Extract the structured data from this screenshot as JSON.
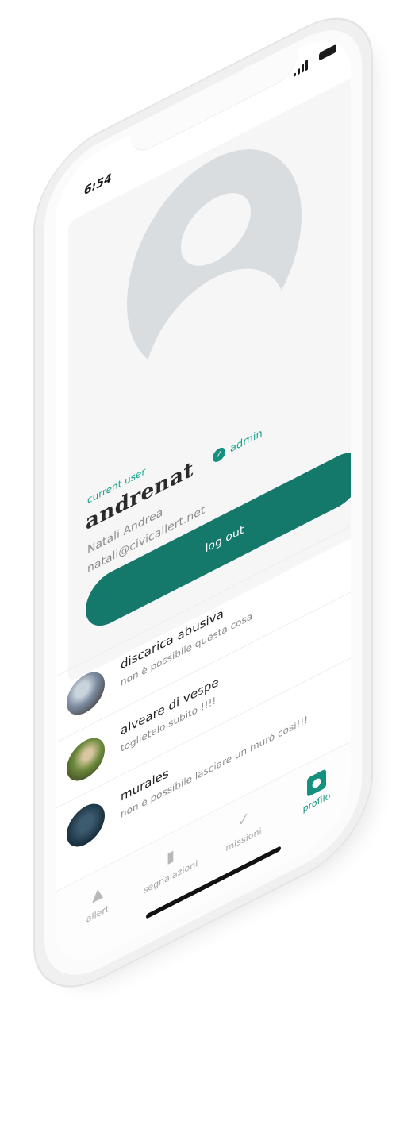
{
  "status_bar": {
    "time": "6:54"
  },
  "profile": {
    "current_user_label": "current user",
    "username": "andrenat",
    "role": "admin",
    "full_name": "Natali Andrea",
    "email": "natali@civicallert.net",
    "logout_label": "log out"
  },
  "reports": [
    {
      "title": "discarica abusiva",
      "subtitle": "non è possibile questa cosa"
    },
    {
      "title": "alveare di vespe",
      "subtitle": "toglietelo subito !!!!"
    },
    {
      "title": "murales",
      "subtitle": "non è possibile lasciare un murò così!!!"
    }
  ],
  "nav": {
    "allert": "allert",
    "segnalazioni": "segnalazioni",
    "missioni": "missioni",
    "profilo": "profilo"
  },
  "colors": {
    "accent": "#13907e",
    "button": "#14796b"
  }
}
